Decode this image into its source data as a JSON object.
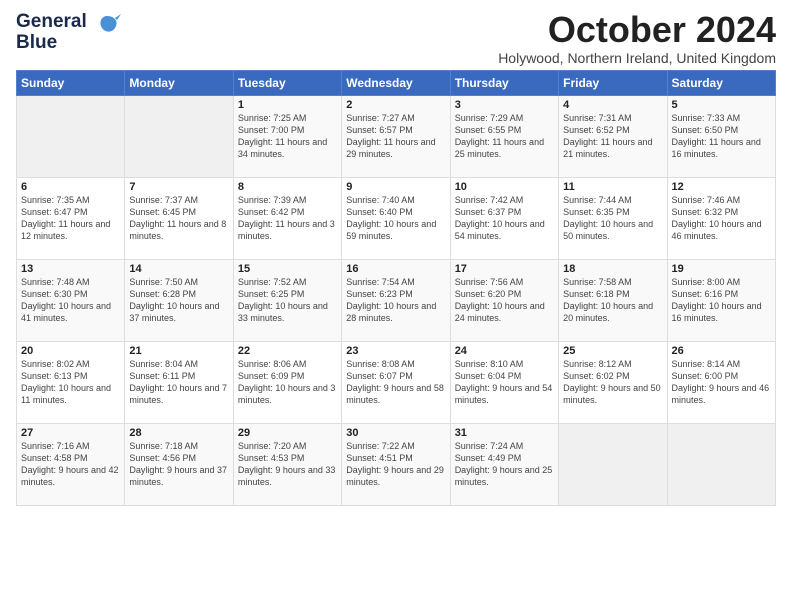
{
  "logo": {
    "line1": "General",
    "line2": "Blue"
  },
  "title": "October 2024",
  "location": "Holywood, Northern Ireland, United Kingdom",
  "days_header": [
    "Sunday",
    "Monday",
    "Tuesday",
    "Wednesday",
    "Thursday",
    "Friday",
    "Saturday"
  ],
  "weeks": [
    [
      {
        "day": "",
        "sunrise": "",
        "sunset": "",
        "daylight": ""
      },
      {
        "day": "",
        "sunrise": "",
        "sunset": "",
        "daylight": ""
      },
      {
        "day": "1",
        "sunrise": "Sunrise: 7:25 AM",
        "sunset": "Sunset: 7:00 PM",
        "daylight": "Daylight: 11 hours and 34 minutes."
      },
      {
        "day": "2",
        "sunrise": "Sunrise: 7:27 AM",
        "sunset": "Sunset: 6:57 PM",
        "daylight": "Daylight: 11 hours and 29 minutes."
      },
      {
        "day": "3",
        "sunrise": "Sunrise: 7:29 AM",
        "sunset": "Sunset: 6:55 PM",
        "daylight": "Daylight: 11 hours and 25 minutes."
      },
      {
        "day": "4",
        "sunrise": "Sunrise: 7:31 AM",
        "sunset": "Sunset: 6:52 PM",
        "daylight": "Daylight: 11 hours and 21 minutes."
      },
      {
        "day": "5",
        "sunrise": "Sunrise: 7:33 AM",
        "sunset": "Sunset: 6:50 PM",
        "daylight": "Daylight: 11 hours and 16 minutes."
      }
    ],
    [
      {
        "day": "6",
        "sunrise": "Sunrise: 7:35 AM",
        "sunset": "Sunset: 6:47 PM",
        "daylight": "Daylight: 11 hours and 12 minutes."
      },
      {
        "day": "7",
        "sunrise": "Sunrise: 7:37 AM",
        "sunset": "Sunset: 6:45 PM",
        "daylight": "Daylight: 11 hours and 8 minutes."
      },
      {
        "day": "8",
        "sunrise": "Sunrise: 7:39 AM",
        "sunset": "Sunset: 6:42 PM",
        "daylight": "Daylight: 11 hours and 3 minutes."
      },
      {
        "day": "9",
        "sunrise": "Sunrise: 7:40 AM",
        "sunset": "Sunset: 6:40 PM",
        "daylight": "Daylight: 10 hours and 59 minutes."
      },
      {
        "day": "10",
        "sunrise": "Sunrise: 7:42 AM",
        "sunset": "Sunset: 6:37 PM",
        "daylight": "Daylight: 10 hours and 54 minutes."
      },
      {
        "day": "11",
        "sunrise": "Sunrise: 7:44 AM",
        "sunset": "Sunset: 6:35 PM",
        "daylight": "Daylight: 10 hours and 50 minutes."
      },
      {
        "day": "12",
        "sunrise": "Sunrise: 7:46 AM",
        "sunset": "Sunset: 6:32 PM",
        "daylight": "Daylight: 10 hours and 46 minutes."
      }
    ],
    [
      {
        "day": "13",
        "sunrise": "Sunrise: 7:48 AM",
        "sunset": "Sunset: 6:30 PM",
        "daylight": "Daylight: 10 hours and 41 minutes."
      },
      {
        "day": "14",
        "sunrise": "Sunrise: 7:50 AM",
        "sunset": "Sunset: 6:28 PM",
        "daylight": "Daylight: 10 hours and 37 minutes."
      },
      {
        "day": "15",
        "sunrise": "Sunrise: 7:52 AM",
        "sunset": "Sunset: 6:25 PM",
        "daylight": "Daylight: 10 hours and 33 minutes."
      },
      {
        "day": "16",
        "sunrise": "Sunrise: 7:54 AM",
        "sunset": "Sunset: 6:23 PM",
        "daylight": "Daylight: 10 hours and 28 minutes."
      },
      {
        "day": "17",
        "sunrise": "Sunrise: 7:56 AM",
        "sunset": "Sunset: 6:20 PM",
        "daylight": "Daylight: 10 hours and 24 minutes."
      },
      {
        "day": "18",
        "sunrise": "Sunrise: 7:58 AM",
        "sunset": "Sunset: 6:18 PM",
        "daylight": "Daylight: 10 hours and 20 minutes."
      },
      {
        "day": "19",
        "sunrise": "Sunrise: 8:00 AM",
        "sunset": "Sunset: 6:16 PM",
        "daylight": "Daylight: 10 hours and 16 minutes."
      }
    ],
    [
      {
        "day": "20",
        "sunrise": "Sunrise: 8:02 AM",
        "sunset": "Sunset: 6:13 PM",
        "daylight": "Daylight: 10 hours and 11 minutes."
      },
      {
        "day": "21",
        "sunrise": "Sunrise: 8:04 AM",
        "sunset": "Sunset: 6:11 PM",
        "daylight": "Daylight: 10 hours and 7 minutes."
      },
      {
        "day": "22",
        "sunrise": "Sunrise: 8:06 AM",
        "sunset": "Sunset: 6:09 PM",
        "daylight": "Daylight: 10 hours and 3 minutes."
      },
      {
        "day": "23",
        "sunrise": "Sunrise: 8:08 AM",
        "sunset": "Sunset: 6:07 PM",
        "daylight": "Daylight: 9 hours and 58 minutes."
      },
      {
        "day": "24",
        "sunrise": "Sunrise: 8:10 AM",
        "sunset": "Sunset: 6:04 PM",
        "daylight": "Daylight: 9 hours and 54 minutes."
      },
      {
        "day": "25",
        "sunrise": "Sunrise: 8:12 AM",
        "sunset": "Sunset: 6:02 PM",
        "daylight": "Daylight: 9 hours and 50 minutes."
      },
      {
        "day": "26",
        "sunrise": "Sunrise: 8:14 AM",
        "sunset": "Sunset: 6:00 PM",
        "daylight": "Daylight: 9 hours and 46 minutes."
      }
    ],
    [
      {
        "day": "27",
        "sunrise": "Sunrise: 7:16 AM",
        "sunset": "Sunset: 4:58 PM",
        "daylight": "Daylight: 9 hours and 42 minutes."
      },
      {
        "day": "28",
        "sunrise": "Sunrise: 7:18 AM",
        "sunset": "Sunset: 4:56 PM",
        "daylight": "Daylight: 9 hours and 37 minutes."
      },
      {
        "day": "29",
        "sunrise": "Sunrise: 7:20 AM",
        "sunset": "Sunset: 4:53 PM",
        "daylight": "Daylight: 9 hours and 33 minutes."
      },
      {
        "day": "30",
        "sunrise": "Sunrise: 7:22 AM",
        "sunset": "Sunset: 4:51 PM",
        "daylight": "Daylight: 9 hours and 29 minutes."
      },
      {
        "day": "31",
        "sunrise": "Sunrise: 7:24 AM",
        "sunset": "Sunset: 4:49 PM",
        "daylight": "Daylight: 9 hours and 25 minutes."
      },
      {
        "day": "",
        "sunrise": "",
        "sunset": "",
        "daylight": ""
      },
      {
        "day": "",
        "sunrise": "",
        "sunset": "",
        "daylight": ""
      }
    ]
  ]
}
